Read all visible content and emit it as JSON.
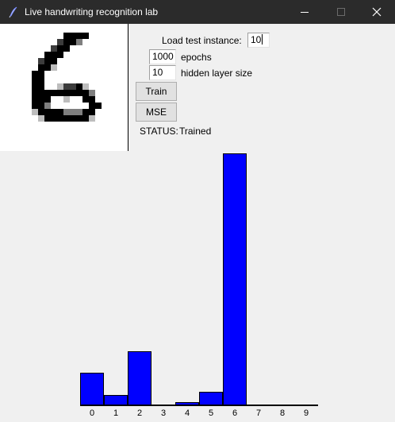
{
  "window": {
    "title": "Live handwriting recognition lab",
    "icon": "feather-pen-icon",
    "controls": [
      "minimize-icon",
      "maximize-icon",
      "close-icon"
    ]
  },
  "drawing": {
    "grid_size": 16,
    "pixels": [
      "................",
      "........@@@@....",
      ".......#@@%.....",
      "......#@@.......",
      ".....@@@........",
      "....#@@.........",
      "....@@:.........",
      "...@@...........",
      "...@@...........",
      "...@@..:##@:....",
      "...@@@@@@@@@%...",
      "...@@@..:..@@...",
      "...@@%......@@..",
      "...:@@@@%%%@@...",
      "....:@@@@@@@:...",
      "................"
    ]
  },
  "controls": {
    "load_label": "Load test instance:",
    "load_value": "10",
    "epochs_value": "1000",
    "epochs_label": "epochs",
    "hidden_value": "10",
    "hidden_label": "hidden layer size",
    "train_label": "Train",
    "mse_label": "MSE",
    "status_label": "STATUS:",
    "status_value": "Trained"
  },
  "chart_data": {
    "type": "bar",
    "categories": [
      "0",
      "1",
      "2",
      "3",
      "4",
      "5",
      "6",
      "7",
      "8",
      "9"
    ],
    "values": [
      0.127,
      0.038,
      0.213,
      0.0,
      0.011,
      0.051,
      1.0,
      0.0,
      0.0,
      0.0
    ],
    "ylim": [
      0,
      1
    ],
    "bar_color": "#0000ff",
    "grid": false,
    "legend": "none"
  }
}
